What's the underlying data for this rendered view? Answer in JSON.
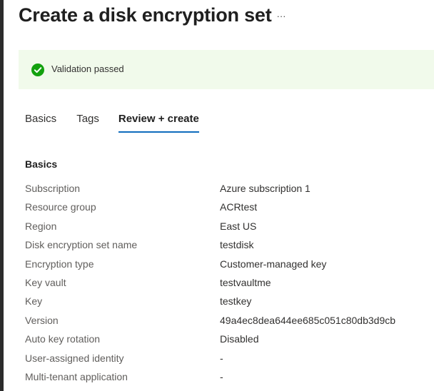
{
  "header": {
    "title": "Create a disk encryption set",
    "more_icon": "ellipsis-icon",
    "more_label": "···"
  },
  "banner": {
    "icon": "check-circle-icon",
    "text": "Validation passed",
    "color_bg": "#f1faeb",
    "color_icon": "#13a10e"
  },
  "tabs": [
    {
      "label": "Basics",
      "active": false
    },
    {
      "label": "Tags",
      "active": false
    },
    {
      "label": "Review + create",
      "active": true
    }
  ],
  "accent_color": "#0f6cbd",
  "section": {
    "title": "Basics",
    "rows": [
      {
        "label": "Subscription",
        "value": "Azure subscription 1"
      },
      {
        "label": "Resource group",
        "value": "ACRtest"
      },
      {
        "label": "Region",
        "value": "East US"
      },
      {
        "label": "Disk encryption set name",
        "value": "testdisk"
      },
      {
        "label": "Encryption type",
        "value": "Customer-managed key"
      },
      {
        "label": "Key vault",
        "value": "testvaultme"
      },
      {
        "label": "Key",
        "value": "testkey"
      },
      {
        "label": "Version",
        "value": "49a4ec8dea644ee685c051c80db3d9cb"
      },
      {
        "label": "Auto key rotation",
        "value": "Disabled"
      },
      {
        "label": "User-assigned identity",
        "value": "-"
      },
      {
        "label": "Multi-tenant application",
        "value": "-"
      }
    ]
  }
}
